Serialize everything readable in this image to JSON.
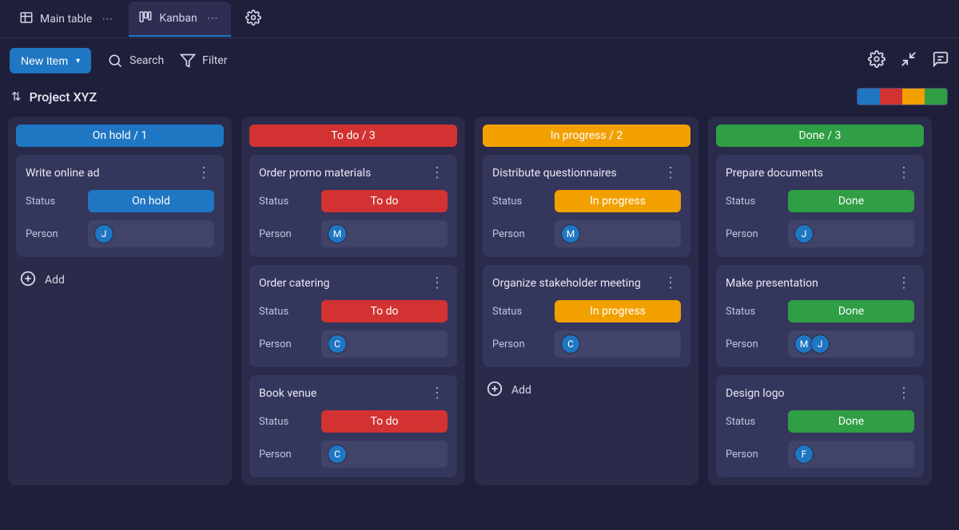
{
  "tabs": [
    {
      "label": "Main table",
      "active": false,
      "icon": "table"
    },
    {
      "label": "Kanban",
      "active": true,
      "icon": "kanban"
    }
  ],
  "toolbar": {
    "new_item": "New Item",
    "search": "Search",
    "filter": "Filter"
  },
  "project": {
    "title": "Project XYZ"
  },
  "legend_colors": [
    "#1f76c2",
    "#d33232",
    "#f2a000",
    "#2f9e44"
  ],
  "labels": {
    "status": "Status",
    "person": "Person",
    "add": "Add"
  },
  "columns": [
    {
      "title": "On hold / 1",
      "color": "c-blue",
      "cards": [
        {
          "title": "Write online ad",
          "status": "On hold",
          "status_color": "c-blue",
          "persons": [
            "J"
          ]
        }
      ],
      "show_add": true
    },
    {
      "title": "To do / 3",
      "color": "c-red",
      "cards": [
        {
          "title": "Order promo materials",
          "status": "To do",
          "status_color": "c-red",
          "persons": [
            "M"
          ]
        },
        {
          "title": "Order catering",
          "status": "To do",
          "status_color": "c-red",
          "persons": [
            "C"
          ]
        },
        {
          "title": "Book venue",
          "status": "To do",
          "status_color": "c-red",
          "persons": [
            "C"
          ]
        }
      ],
      "show_add": false
    },
    {
      "title": "In progress / 2",
      "color": "c-orange",
      "cards": [
        {
          "title": "Distribute questionnaires",
          "status": "In progress",
          "status_color": "c-orange",
          "persons": [
            "M"
          ]
        },
        {
          "title": "Organize stakeholder meeting",
          "status": "In progress",
          "status_color": "c-orange",
          "persons": [
            "C"
          ]
        }
      ],
      "show_add": true
    },
    {
      "title": "Done / 3",
      "color": "c-green",
      "cards": [
        {
          "title": "Prepare documents",
          "status": "Done",
          "status_color": "c-green",
          "persons": [
            "J"
          ]
        },
        {
          "title": "Make presentation",
          "status": "Done",
          "status_color": "c-green",
          "persons": [
            "M",
            "J"
          ]
        },
        {
          "title": "Design logo",
          "status": "Done",
          "status_color": "c-green",
          "persons": [
            "F"
          ]
        }
      ],
      "show_add": false
    }
  ]
}
